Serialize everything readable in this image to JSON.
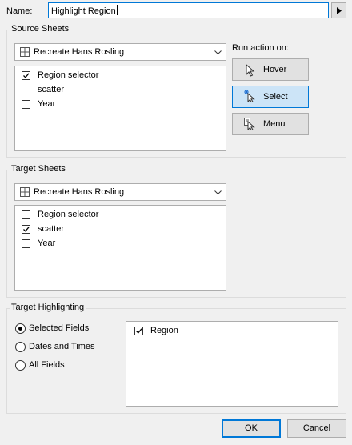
{
  "name_field": {
    "label": "Name:",
    "value": "Highlight Region"
  },
  "source": {
    "title": "Source Sheets",
    "dropdown": "Recreate Hans Rosling",
    "items": [
      {
        "label": "Region selector",
        "checked": true
      },
      {
        "label": "scatter",
        "checked": false
      },
      {
        "label": "Year",
        "checked": false
      }
    ]
  },
  "run_action": {
    "label": "Run action on:",
    "buttons": [
      {
        "label": "Hover",
        "icon": "hover-cursor-icon",
        "selected": false
      },
      {
        "label": "Select",
        "icon": "select-cursor-icon",
        "selected": true
      },
      {
        "label": "Menu",
        "icon": "menu-cursor-icon",
        "selected": false
      }
    ]
  },
  "target": {
    "title": "Target Sheets",
    "dropdown": "Recreate Hans Rosling",
    "items": [
      {
        "label": "Region selector",
        "checked": false
      },
      {
        "label": "scatter",
        "checked": true
      },
      {
        "label": "Year",
        "checked": false
      }
    ]
  },
  "highlighting": {
    "title": "Target Highlighting",
    "options": [
      {
        "label": "Selected Fields",
        "selected": true
      },
      {
        "label": "Dates and Times",
        "selected": false
      },
      {
        "label": "All Fields",
        "selected": false
      }
    ],
    "fields": [
      {
        "label": "Region",
        "checked": true
      }
    ]
  },
  "buttons": {
    "ok": "OK",
    "cancel": "Cancel"
  },
  "colors": {
    "accent": "#0078d7",
    "selected_bg": "#cce4f7",
    "dialog_bg": "#f0f0f0"
  }
}
